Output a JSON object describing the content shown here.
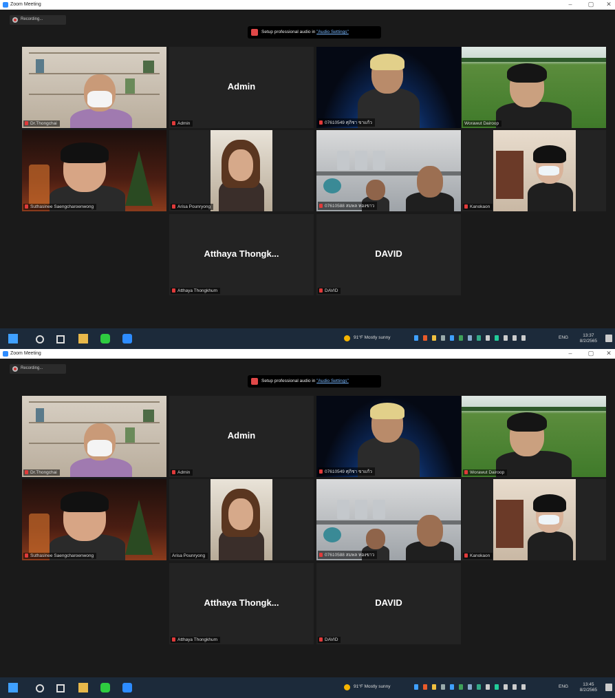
{
  "window_title": "Zoom Meeting",
  "recording_label": "Recording...",
  "banner": {
    "text": "Setup professional audio in ",
    "link": "\"Audio Settings\""
  },
  "screens": [
    {
      "tiles": [
        {
          "name": "Dr.Thongchai",
          "video": "bookshelf",
          "active": false
        },
        {
          "name": "Admin",
          "big": "Admin",
          "active": false
        },
        {
          "name": "07610549 ศุภิชา ขาแก้ว",
          "video": "space",
          "active": false
        },
        {
          "name": "Worawut Dairoop",
          "video": "field",
          "active": true
        },
        {
          "name": "Suthasinee Saengcharoenwong",
          "video": "christmas",
          "active": false
        },
        {
          "name": "Arisa Pounryong",
          "video": "room",
          "active": false
        },
        {
          "name": "07610588 สมพล ทองขาว",
          "video": "kitchen",
          "active": false
        },
        {
          "name": "Kanokaon",
          "video": "office",
          "active": false
        },
        {
          "name": "Atthaya Thongkhum",
          "big": "Atthaya Thongk...",
          "active": false
        },
        {
          "name": "DAVID",
          "big": "DAVID",
          "active": false
        }
      ],
      "clock": {
        "time": "13:37",
        "date": "8/2/2565"
      }
    },
    {
      "tiles": [
        {
          "name": "Dr.Thongchai",
          "video": "bookshelf",
          "active": false
        },
        {
          "name": "Admin",
          "big": "Admin",
          "active": false
        },
        {
          "name": "07610549 ศุภิชา ขาแก้ว",
          "video": "space",
          "active": false
        },
        {
          "name": "Worawut Dairoop",
          "video": "field",
          "active": false
        },
        {
          "name": "Suthasinee Saengcharoenwong",
          "video": "christmas",
          "active": false
        },
        {
          "name": "Arisa Pounryong",
          "video": "room",
          "active": true
        },
        {
          "name": "07610588 สมพล ทองขาว",
          "video": "kitchen",
          "active": false
        },
        {
          "name": "Kanokaon",
          "video": "office",
          "active": false
        },
        {
          "name": "Atthaya Thongkhum",
          "big": "Atthaya Thongk...",
          "active": false
        },
        {
          "name": "DAVID",
          "big": "DAVID",
          "active": false
        }
      ],
      "clock": {
        "time": "13:45",
        "date": "8/2/2565"
      }
    }
  ],
  "taskbar": {
    "weather": "91°F  Mostly sunny",
    "language": "ENG",
    "icons": [
      "windows-start-icon",
      "search-icon",
      "task-view-icon",
      "file-explorer-icon",
      "line-app-icon",
      "zoom-app-icon"
    ]
  },
  "colors": {
    "active_border": "#c8e66a",
    "tile_bg": "#232323",
    "stage_bg": "#1a1a1a",
    "taskbar_bg": "#1c2a3a",
    "mute_red": "#e03a3a"
  }
}
